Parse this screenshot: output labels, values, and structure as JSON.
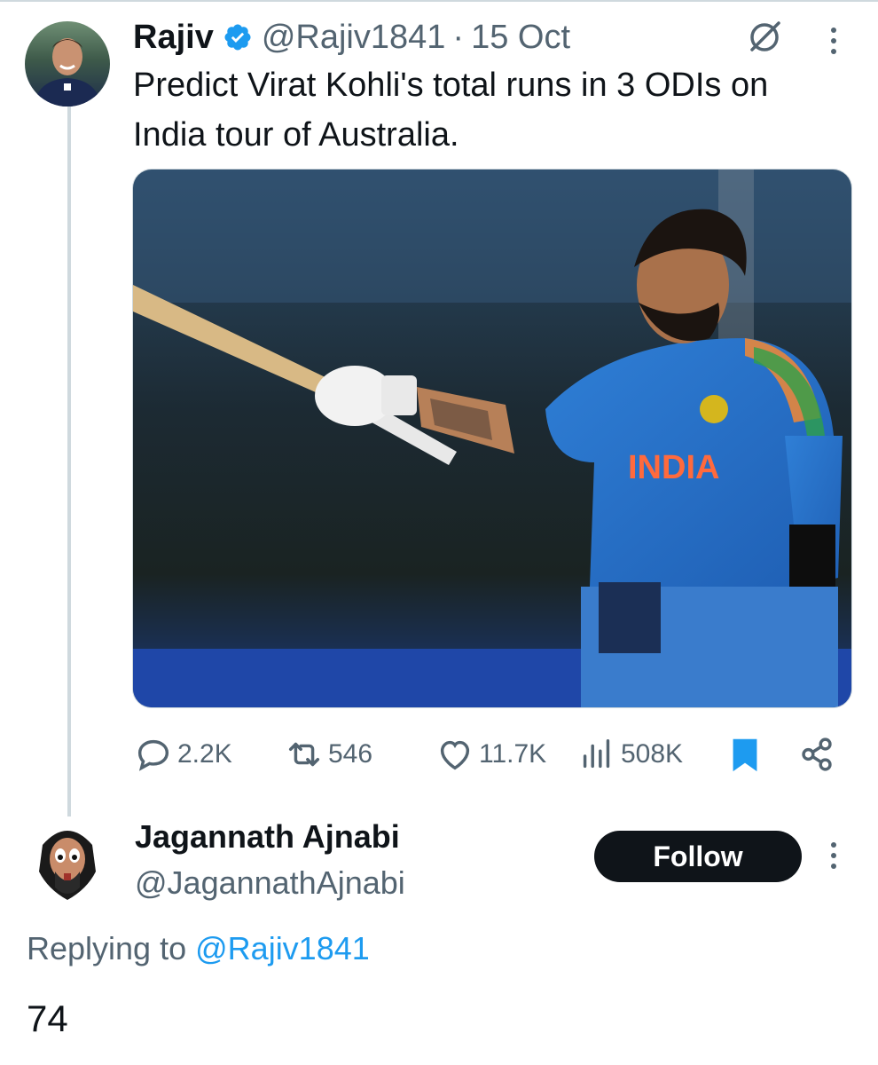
{
  "tweet": {
    "author": {
      "display_name": "Rajiv",
      "handle": "@Rajiv1841",
      "separator": "·",
      "date": "15 Oct",
      "verified": true
    },
    "text": "Predict Virat Kohli's total runs in 3 ODIs on India tour of Australia.",
    "media": {
      "jersey_text": "INDIA"
    },
    "actions": {
      "replies": "2.2K",
      "retweets": "546",
      "likes": "11.7K",
      "views": "508K"
    }
  },
  "reply": {
    "author": {
      "display_name": "Jagannath Ajnabi",
      "handle": "@JagannathAjnabi"
    },
    "follow_label": "Follow",
    "replying_prefix": "Replying to",
    "replying_to": "@Rajiv1841",
    "text": "74"
  },
  "colors": {
    "text_primary": "#0f1419",
    "text_secondary": "#536471",
    "accent": "#1d9bf0",
    "follow_bg": "#0f1419"
  },
  "icons": [
    "verified-badge-icon",
    "grok-icon",
    "more-icon",
    "reply-icon",
    "retweet-icon",
    "like-icon",
    "views-icon",
    "bookmark-icon",
    "share-icon"
  ]
}
